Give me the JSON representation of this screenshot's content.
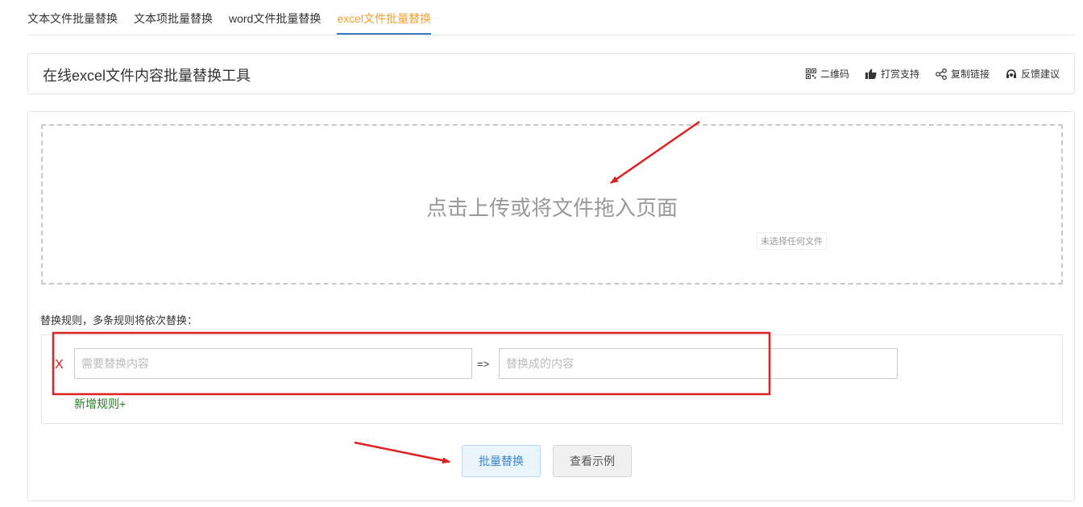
{
  "tabs": [
    {
      "label": "文本文件批量替换",
      "active": false
    },
    {
      "label": "文本项批量替换",
      "active": false
    },
    {
      "label": "word文件批量替换",
      "active": false
    },
    {
      "label": "excel文件批量替换",
      "active": true
    }
  ],
  "header": {
    "title": "在线excel文件内容批量替换工具",
    "actions": [
      {
        "label": "二维码",
        "icon": "qrcode-icon"
      },
      {
        "label": "打赏支持",
        "icon": "thumbs-up-icon"
      },
      {
        "label": "复制链接",
        "icon": "share-icon"
      },
      {
        "label": "反馈建议",
        "icon": "feedback-icon"
      }
    ]
  },
  "upload": {
    "prompt": "点击上传或将文件拖入页面",
    "file_status": "未选择任何文件"
  },
  "rules": {
    "label": "替换规则，多条规则将依次替换：",
    "remove_label": "X",
    "from_placeholder": "需要替换内容",
    "to_placeholder": "替换成的内容",
    "separator": "=>",
    "add_rule_label": "新增规则+"
  },
  "buttons": {
    "replace_label": "批量替换",
    "example_label": "查看示例"
  },
  "colors": {
    "active_tab": "#f0a232",
    "annotation_red": "#e02020",
    "add_rule_green": "#237c23",
    "primary_button_text": "#3a86c8"
  }
}
